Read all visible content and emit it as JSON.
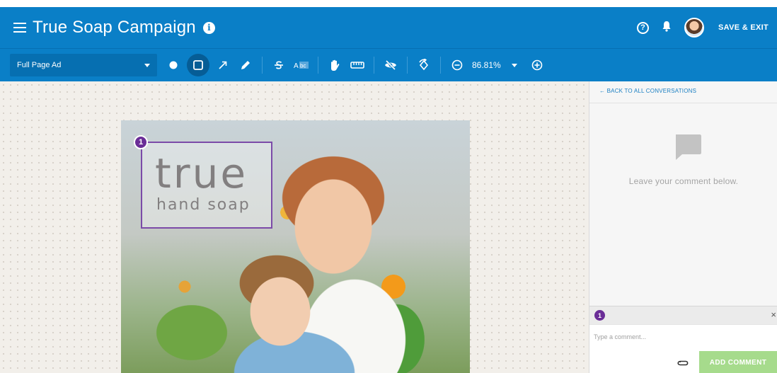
{
  "header": {
    "title": "True Soap Campaign",
    "help_glyph": "?",
    "save_exit_label": "SAVE & EXIT"
  },
  "toolbar": {
    "page_select_value": "Full Page Ad",
    "active_tool": "rectangle",
    "zoom": "86.81%",
    "tools": [
      "dot-tool",
      "rectangle-tool",
      "arrow-tool",
      "pen-tool",
      "strikethrough-tool",
      "text-replace-tool",
      "hand-tool",
      "ruler-tool",
      "hide-annotations-tool",
      "rotate-tool",
      "zoom-out",
      "zoom-in"
    ]
  },
  "canvas": {
    "ad_logo_big": "true",
    "ad_logo_small": "hand soap",
    "annotation_number": "1",
    "annotation_color": "#7b4aa8"
  },
  "panel": {
    "back_link": "← BACK TO ALL CONVERSATIONS",
    "empty_message": "Leave your comment below.",
    "composer_number": "1",
    "close_glyph": "×",
    "comment_placeholder": "Type a comment...",
    "add_comment_label": "ADD COMMENT"
  },
  "colors": {
    "brand_blue": "#0a7fc7",
    "pin_purple": "#6a2d97",
    "add_button_green": "#a6db8c"
  }
}
